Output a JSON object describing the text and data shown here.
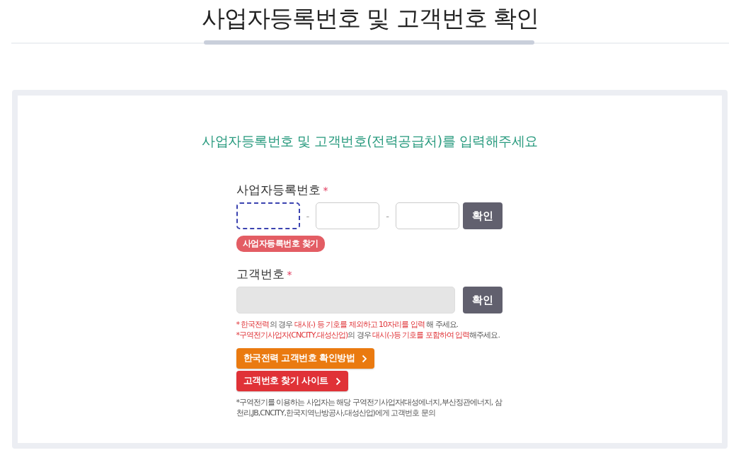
{
  "page_title": "사업자등록번호 및 고객번호 확인",
  "form": {
    "heading": "사업자등록번호 및 고객번호(전력공급처)를 입력해주세요",
    "business_number": {
      "label": "사업자등록번호",
      "required_mark": "*",
      "fields": [
        {
          "focused": true,
          "disabled": false
        },
        {
          "focused": false,
          "disabled": false
        },
        {
          "focused": false,
          "disabled": false
        }
      ],
      "separators": [
        "-",
        "-"
      ],
      "confirm_button": "확인",
      "find_link": "사업자등록번호 찾기"
    },
    "customer_number": {
      "label": "고객번호",
      "required_mark": "*",
      "field": {
        "disabled": true
      },
      "confirm_button": "확인"
    },
    "notes": [
      [
        {
          "text": "* 한국전력",
          "emphasis": true
        },
        {
          "text": "의 경우 ",
          "emphasis": false
        },
        {
          "text": "대시(-) 등 기호를 제외하고 10자리를 입력",
          "emphasis": true
        },
        {
          "text": " 해 주세요.",
          "emphasis": false
        }
      ],
      [
        {
          "text": "*구역전기사업자(CNCITY,대성산업)",
          "emphasis": true
        },
        {
          "text": "의 경우 ",
          "emphasis": false
        },
        {
          "text": "대시(-)등 기호를 포함하여 입력",
          "emphasis": true
        },
        {
          "text": "해주세요.",
          "emphasis": false
        }
      ]
    ],
    "link_buttons": [
      {
        "label": "한국전력 고객번호 확인방법",
        "kind": "orange"
      },
      {
        "label": "고객번호 찾기 사이트",
        "kind": "red"
      }
    ],
    "footnote": "*구역전기를 이용하는 사업자는 해당 구역전기사업자(대성에너지,부산정관에너지, 삼천리,JB,CNCITY,한국지역난방공사,대성산업)에게 고객번호 문의"
  }
}
